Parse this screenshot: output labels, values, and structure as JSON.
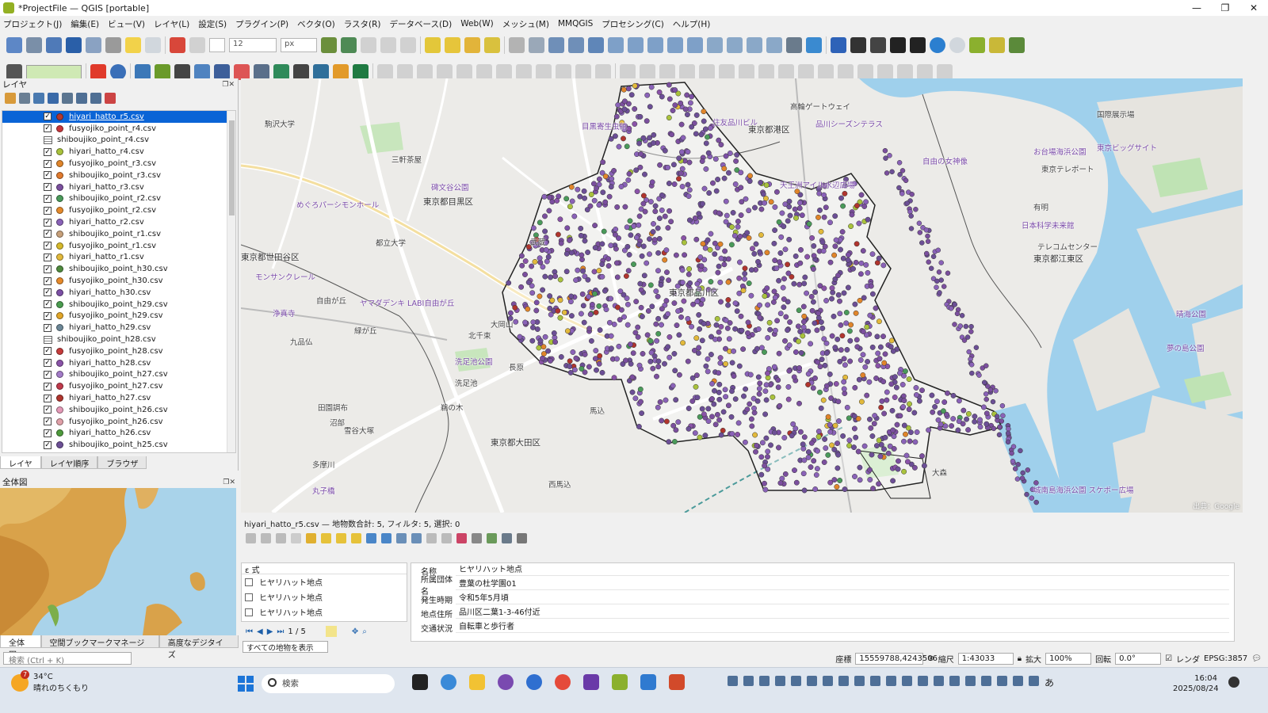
{
  "window": {
    "title": "*ProjectFile — QGIS [portable]",
    "controls": [
      "—",
      "❐",
      "✕"
    ]
  },
  "menu": [
    "プロジェクト(J)",
    "編集(E)",
    "ビュー(V)",
    "レイヤ(L)",
    "設定(S)",
    "プラグイン(P)",
    "ベクタ(O)",
    "ラスタ(R)",
    "データベース(D)",
    "Web(W)",
    "メッシュ(M)",
    "MMQGIS",
    "プロセシング(C)",
    "ヘルプ(H)"
  ],
  "toolbar": {
    "font_size": "12",
    "font_unit": "px"
  },
  "layers_panel": {
    "title": "レイヤ",
    "layers": [
      {
        "name": "hiyari_hatto_r5.csv",
        "checked": true,
        "color": "#b5392f",
        "selected": true
      },
      {
        "name": "fusyojiko_point_r4.csv",
        "checked": true,
        "color": "#c6363b"
      },
      {
        "name": "shiboujiko_point_r4.csv",
        "checked": false,
        "color": "table"
      },
      {
        "name": "hiyari_hatto_r4.csv",
        "checked": true,
        "color": "#a9c23c"
      },
      {
        "name": "fusyojiko_point_r3.csv",
        "checked": true,
        "color": "#e0852a"
      },
      {
        "name": "shiboujiko_point_r3.csv",
        "checked": true,
        "color": "#e07a2e"
      },
      {
        "name": "hiyari_hatto_r3.csv",
        "checked": true,
        "color": "#7b4f9e"
      },
      {
        "name": "shiboujiko_point_r2.csv",
        "checked": true,
        "color": "#4a9a5a"
      },
      {
        "name": "fusyojiko_point_r2.csv",
        "checked": true,
        "color": "#e58a2b"
      },
      {
        "name": "hiyari_hatto_r2.csv",
        "checked": true,
        "color": "#8a62b8"
      },
      {
        "name": "shiboujiko_point_r1.csv",
        "checked": true,
        "color": "#c7a07a"
      },
      {
        "name": "fusyojiko_point_r1.csv",
        "checked": true,
        "color": "#d6b92a"
      },
      {
        "name": "hiyari_hatto_r1.csv",
        "checked": true,
        "color": "#e2b93b"
      },
      {
        "name": "shiboujiko_point_h30.csv",
        "checked": true,
        "color": "#4f8a3d"
      },
      {
        "name": "fusyojiko_point_h30.csv",
        "checked": true,
        "color": "#e78a2a"
      },
      {
        "name": "hiyari_hatto_h30.csv",
        "checked": true,
        "color": "#7c4fa5"
      },
      {
        "name": "shiboujiko_point_h29.csv",
        "checked": true,
        "color": "#4a9c4f"
      },
      {
        "name": "fusyojiko_point_h29.csv",
        "checked": true,
        "color": "#e2a628"
      },
      {
        "name": "hiyari_hatto_h29.csv",
        "checked": true,
        "color": "#6c8797"
      },
      {
        "name": "shiboujiko_point_h28.csv",
        "checked": false,
        "color": "table"
      },
      {
        "name": "fusyojiko_point_h28.csv",
        "checked": true,
        "color": "#c63c3c"
      },
      {
        "name": "hiyari_hatto_h28.csv",
        "checked": true,
        "color": "#8a53a8"
      },
      {
        "name": "shiboujiko_point_h27.csv",
        "checked": true,
        "color": "#a37bc8"
      },
      {
        "name": "fusyojiko_point_h27.csv",
        "checked": true,
        "color": "#c03a4c"
      },
      {
        "name": "hiyari_hatto_h27.csv",
        "checked": true,
        "color": "#b0352e"
      },
      {
        "name": "shiboujiko_point_h26.csv",
        "checked": true,
        "color": "#e59ab8"
      },
      {
        "name": "fusyojiko_point_h26.csv",
        "checked": true,
        "color": "#e0a0a8"
      },
      {
        "name": "hiyari_hatto_h26.csv",
        "checked": true,
        "color": "#4e9a3c"
      },
      {
        "name": "shiboujiko_point_h25.csv",
        "checked": true,
        "color": "#6c4f96"
      }
    ],
    "tabs": [
      "レイヤ",
      "レイヤ順序",
      "ブラウザ"
    ]
  },
  "overview_panel": {
    "title": "全体図",
    "tabs": [
      "全体図",
      "空間ブックマークマネージャ",
      "高度なデジタイズ"
    ]
  },
  "search_placeholder": "検索 (Ctrl + K)",
  "map": {
    "labels": [
      {
        "text": "駒沢大学",
        "kind": "station"
      },
      {
        "text": "三軒茶屋",
        "kind": "station"
      },
      {
        "text": "碑文谷公園",
        "kind": "poi"
      },
      {
        "text": "東京都目黒区",
        "kind": "ward"
      },
      {
        "text": "東京都世田谷区",
        "kind": "ward"
      },
      {
        "text": "都立大学",
        "kind": "station"
      },
      {
        "text": "めぐろパーシモンホール",
        "kind": "poi"
      },
      {
        "text": "モンサンクレール",
        "kind": "poi"
      },
      {
        "text": "自由が丘",
        "kind": "station"
      },
      {
        "text": "ヤマダデンキ LABI自由が丘",
        "kind": "poi"
      },
      {
        "text": "九品仏",
        "kind": "station"
      },
      {
        "text": "洗足池公園",
        "kind": "poi"
      },
      {
        "text": "洗足池",
        "kind": "station"
      },
      {
        "text": "東京都大田区",
        "kind": "ward"
      },
      {
        "text": "田園調布",
        "kind": "station"
      },
      {
        "text": "雪谷大塚",
        "kind": "station"
      },
      {
        "text": "長原",
        "kind": "station"
      },
      {
        "text": "馬込",
        "kind": "station"
      },
      {
        "text": "西馬込",
        "kind": "station"
      },
      {
        "text": "東京都品川区",
        "kind": "ward"
      },
      {
        "text": "目黒寄生虫館",
        "kind": "poi"
      },
      {
        "text": "住友品川ビル",
        "kind": "poi"
      },
      {
        "text": "東京都港区",
        "kind": "ward"
      },
      {
        "text": "品川シーズンテラス",
        "kind": "poi"
      },
      {
        "text": "高輪ゲートウェイ",
        "kind": "station"
      },
      {
        "text": "天王洲アイル水辺広場",
        "kind": "poi"
      },
      {
        "text": "自由の女神像",
        "kind": "poi"
      },
      {
        "text": "お台場海浜公園",
        "kind": "poi"
      },
      {
        "text": "東京テレポート",
        "kind": "station"
      },
      {
        "text": "東京都江東区",
        "kind": "ward"
      },
      {
        "text": "日本科学未来館",
        "kind": "poi"
      },
      {
        "text": "テレコムセンター",
        "kind": "station"
      },
      {
        "text": "東京ビッグサイト",
        "kind": "poi"
      },
      {
        "text": "国際展示場",
        "kind": "station"
      },
      {
        "text": "有明",
        "kind": "station"
      },
      {
        "text": "晴海公園",
        "kind": "poi"
      },
      {
        "text": "夢の島公園",
        "kind": "poi"
      },
      {
        "text": "城南島海浜公園 スケボー広場",
        "kind": "poi"
      },
      {
        "text": "大森",
        "kind": "station"
      },
      {
        "text": "大岡山",
        "kind": "station"
      },
      {
        "text": "緑が丘",
        "kind": "station"
      },
      {
        "text": "北千束",
        "kind": "station"
      },
      {
        "text": "鵜の木",
        "kind": "station"
      },
      {
        "text": "多摩川",
        "kind": "station"
      },
      {
        "text": "丸子橋",
        "kind": "poi"
      },
      {
        "text": "沼部",
        "kind": "station"
      },
      {
        "text": "浄真寺",
        "kind": "poi"
      },
      {
        "text": "武蔵",
        "kind": "station"
      }
    ],
    "attribution": "出典：Google"
  },
  "attribute_panel": {
    "title": "hiyari_hatto_r5.csv — 地物数合計: 5, フィルタ: 5, 選択: 0",
    "expression_label": "式",
    "features": [
      "ヒヤリハット地点",
      "ヒヤリハット地点",
      "ヒヤリハット地点"
    ],
    "nav": "1 / 5",
    "show_all": "すべての地物を表示",
    "form": [
      {
        "label": "名称",
        "value": "ヒヤリハット地点"
      },
      {
        "label": "所属団体名",
        "value": "豊葉の杜学園01"
      },
      {
        "label": "発生時期",
        "value": "令和5年5月頃"
      },
      {
        "label": "地点住所",
        "value": "品川区二葉1-3-46付近"
      },
      {
        "label": "交通状況",
        "value": "自転車と歩行者"
      }
    ]
  },
  "status": {
    "coord_label": "座標",
    "coord_value": "15559788,4243506",
    "scale_label": "縮尺",
    "scale_value": "1:43033",
    "magnifier_label": "拡大",
    "magnifier_value": "100%",
    "rotation_label": "回転",
    "rotation_value": "0.0°",
    "render_label": "レンダ",
    "crs": "EPSG:3857"
  },
  "taskbar": {
    "temp": "34°C",
    "weather": "晴れのちくもり",
    "weather_badge": "7",
    "search": "検索",
    "time": "16:04",
    "date": "2025/08/24",
    "ime": "あ"
  }
}
